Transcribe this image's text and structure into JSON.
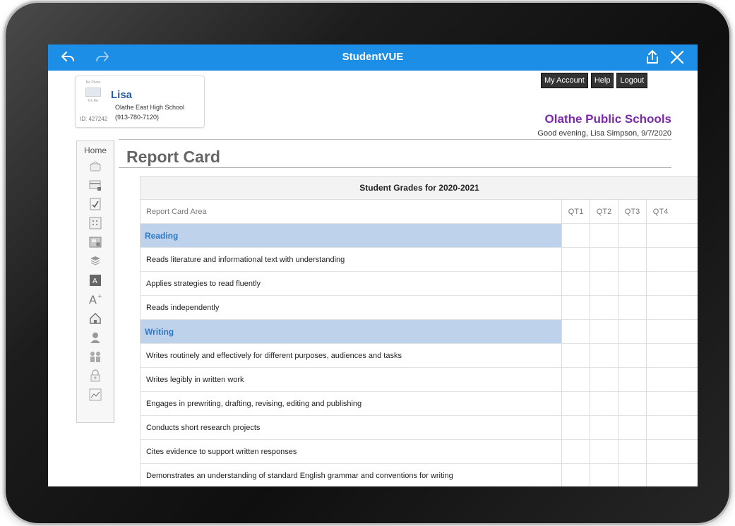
{
  "app": {
    "title": "StudentVUE"
  },
  "student": {
    "name": "Lisa",
    "school": "Olathe East High School",
    "phone": "(913-780-7120)",
    "id_label": "ID: 427242",
    "photo_text_1": "No Photo",
    "photo_text_2": "On file"
  },
  "header": {
    "buttons": [
      "My Account",
      "Help",
      "Logout"
    ],
    "district": "Olathe Public Schools",
    "greeting": "Good evening, Lisa Simpson, 9/7/2020"
  },
  "sidebar": {
    "home_label": "Home",
    "icons": [
      "home-icon",
      "credit-card-icon",
      "checklist-icon",
      "class-schedule-icon",
      "grade-book-icon",
      "course-history-icon",
      "report-card-icon",
      "test-scores-icon",
      "school-info-icon",
      "student-info-icon",
      "parent-icon",
      "lock-icon",
      "chart-icon"
    ]
  },
  "page": {
    "title": "Report Card"
  },
  "report": {
    "table_title": "Student Grades for 2020-2021",
    "column_header": "Report Card Area",
    "quarters": [
      "QT1",
      "QT2",
      "QT3",
      "QT4"
    ],
    "rows": [
      {
        "type": "section",
        "label": "Reading"
      },
      {
        "type": "item",
        "label": "Reads literature and informational text with understanding"
      },
      {
        "type": "item",
        "label": "Applies strategies to read fluently"
      },
      {
        "type": "item",
        "label": "Reads independently"
      },
      {
        "type": "section",
        "label": "Writing"
      },
      {
        "type": "item",
        "label": "Writes routinely and effectively for different purposes, audiences and tasks"
      },
      {
        "type": "item",
        "label": "Writes legibly in written work"
      },
      {
        "type": "item",
        "label": "Engages in prewriting, drafting, revising, editing and publishing"
      },
      {
        "type": "item",
        "label": "Conducts short research projects"
      },
      {
        "type": "item",
        "label": "Cites evidence to support written responses"
      },
      {
        "type": "item",
        "label": "Demonstrates an understanding of standard English grammar and conventions for writing"
      }
    ]
  },
  "colors": {
    "topbar": "#1d8ee6",
    "section_bg": "#bed2ec",
    "section_text": "#2f78c4",
    "district": "#7a2aa8",
    "student_name": "#2a5d9e"
  }
}
